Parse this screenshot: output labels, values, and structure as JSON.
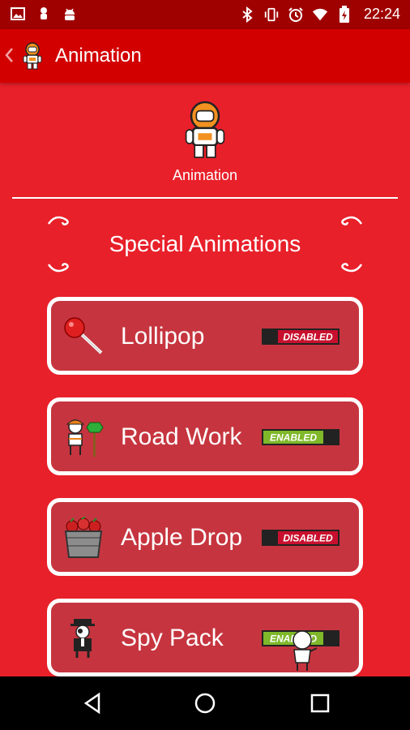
{
  "status_bar": {
    "time": "22:24",
    "icons": [
      "image-icon",
      "android-icon",
      "android-debug-icon",
      "bluetooth-icon",
      "vibrate-icon",
      "alarm-icon",
      "wifi-icon",
      "battery-icon"
    ]
  },
  "app_bar": {
    "title": "Animation",
    "back_icon": "chevron-left-icon",
    "app_icon": "astronaut-icon"
  },
  "hero": {
    "label": "Animation",
    "icon": "astronaut-icon"
  },
  "section": {
    "title": "Special Animations"
  },
  "animations": [
    {
      "name": "Lollipop",
      "icon": "lollipop-icon",
      "status": "DISABLED",
      "enabled": false
    },
    {
      "name": "Road Work",
      "icon": "road-worker-icon",
      "status": "ENABLED",
      "enabled": true
    },
    {
      "name": "Apple Drop",
      "icon": "apple-bucket-icon",
      "status": "DISABLED",
      "enabled": false
    },
    {
      "name": "Spy Pack",
      "icon": "spy-icon",
      "status": "ENABLED",
      "enabled": true
    }
  ],
  "nav_bar": {
    "items": [
      "back-triangle-icon",
      "home-circle-icon",
      "recents-square-icon"
    ]
  },
  "colors": {
    "status_bar": "#9f0000",
    "app_bar": "#d30000",
    "background": "#e8202a",
    "card_fill": "#c6353f",
    "enabled_green": "#7fb82a",
    "disabled_red": "#c8102e"
  }
}
